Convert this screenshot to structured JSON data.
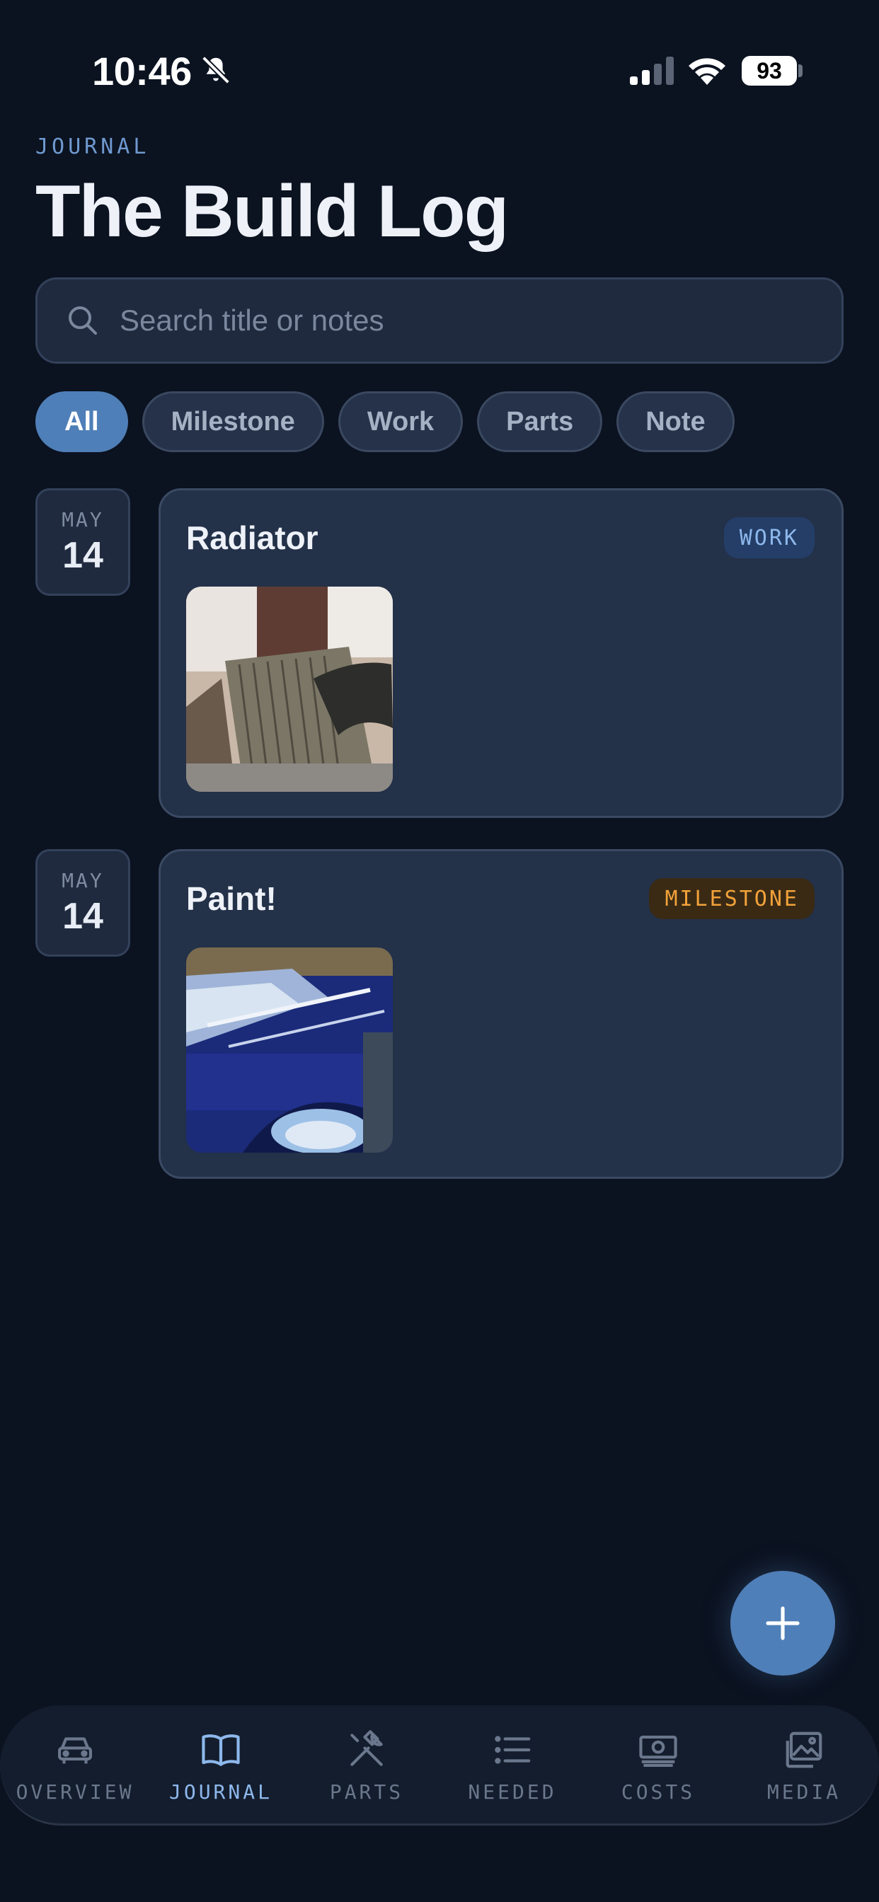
{
  "status_bar": {
    "time": "10:46",
    "battery": "93",
    "icons": [
      "bell-slash-icon",
      "cellular-signal-icon",
      "wifi-icon",
      "battery-icon"
    ]
  },
  "header": {
    "eyebrow": "JOURNAL",
    "title": "The Build Log"
  },
  "search": {
    "placeholder": "Search title or notes",
    "value": ""
  },
  "filters": [
    {
      "label": "All",
      "selected": true
    },
    {
      "label": "Milestone",
      "selected": false
    },
    {
      "label": "Work",
      "selected": false
    },
    {
      "label": "Parts",
      "selected": false
    },
    {
      "label": "Note",
      "selected": false
    }
  ],
  "entries": [
    {
      "month": "MAY",
      "day": "14",
      "title": "Radiator",
      "tag": "WORK",
      "photo": "radiator-photo"
    },
    {
      "month": "MAY",
      "day": "14",
      "title": "Paint!",
      "tag": "MILESTONE",
      "photo": "blue-car-paint-photo"
    }
  ],
  "fab": {
    "icon": "plus-icon"
  },
  "tabbar": {
    "tabs": [
      {
        "label": "OVERVIEW",
        "icon": "car-icon",
        "active": false
      },
      {
        "label": "JOURNAL",
        "icon": "book-open-icon",
        "active": true
      },
      {
        "label": "PARTS",
        "icon": "tools-icon",
        "active": false
      },
      {
        "label": "NEEDED",
        "icon": "list-icon",
        "active": false
      },
      {
        "label": "COSTS",
        "icon": "cash-icon",
        "active": false
      },
      {
        "label": "MEDIA",
        "icon": "images-icon",
        "active": false
      }
    ]
  },
  "colors": {
    "background": "#0b1220",
    "card": "#233149",
    "accent": "#4f7fb8",
    "work_tag": "#8db8ec",
    "milestone_tag": "#f2a23a"
  }
}
